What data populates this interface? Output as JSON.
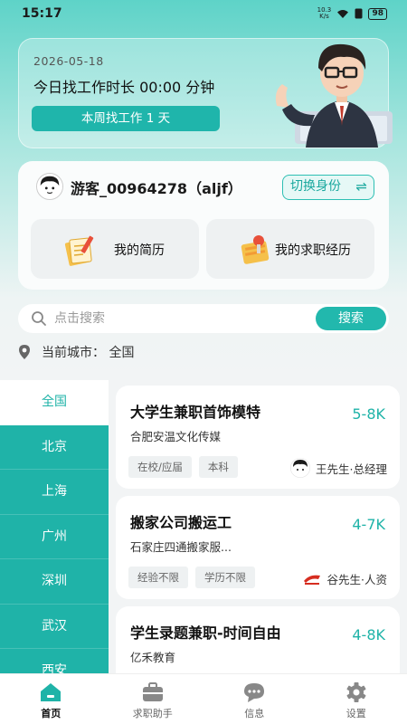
{
  "status_bar": {
    "time": "15:17",
    "net_speed_top": "10.3",
    "net_speed_bottom": "K/s",
    "battery": "98"
  },
  "summary": {
    "date": "2026-05-18",
    "duration_text": "今日找工作时长 00:00 分钟",
    "week_badge": "本周找工作 1 天"
  },
  "user": {
    "name": "游客_00964278（aljf）",
    "switch_label": "切换身份",
    "tiles": [
      {
        "label": "我的简历",
        "icon": "resume-icon"
      },
      {
        "label": "我的求职经历",
        "icon": "job-history-icon"
      }
    ]
  },
  "search": {
    "placeholder": "点击搜索",
    "button": "搜索"
  },
  "city": {
    "label": "当前城市：  全国"
  },
  "cities": [
    "全国",
    "北京",
    "上海",
    "广州",
    "深圳",
    "武汉",
    "西安"
  ],
  "active_city": "全国",
  "jobs": [
    {
      "title": "大学生兼职首饰模特",
      "salary": "5-8K",
      "company": "合肥安温文化传媒",
      "tags": [
        "在校/应届",
        "本科"
      ],
      "contact": "王先生·总经理"
    },
    {
      "title": "搬家公司搬运工",
      "salary": "4-7K",
      "company": "石家庄四通搬家服...",
      "tags": [
        "经验不限",
        "学历不限"
      ],
      "contact": "谷先生·人资"
    },
    {
      "title": "学生录题兼职-时间自由",
      "salary": "4-8K",
      "company": "亿禾教育",
      "tags": [],
      "contact": ""
    }
  ],
  "nav": [
    {
      "label": "首页",
      "icon": "home-icon",
      "active": true
    },
    {
      "label": "求职助手",
      "icon": "briefcase-icon",
      "active": false
    },
    {
      "label": "信息",
      "icon": "chat-icon",
      "active": false
    },
    {
      "label": "设置",
      "icon": "gear-icon",
      "active": false
    }
  ],
  "colors": {
    "accent": "#1fb3a8",
    "header_top": "#5ed3c8"
  }
}
